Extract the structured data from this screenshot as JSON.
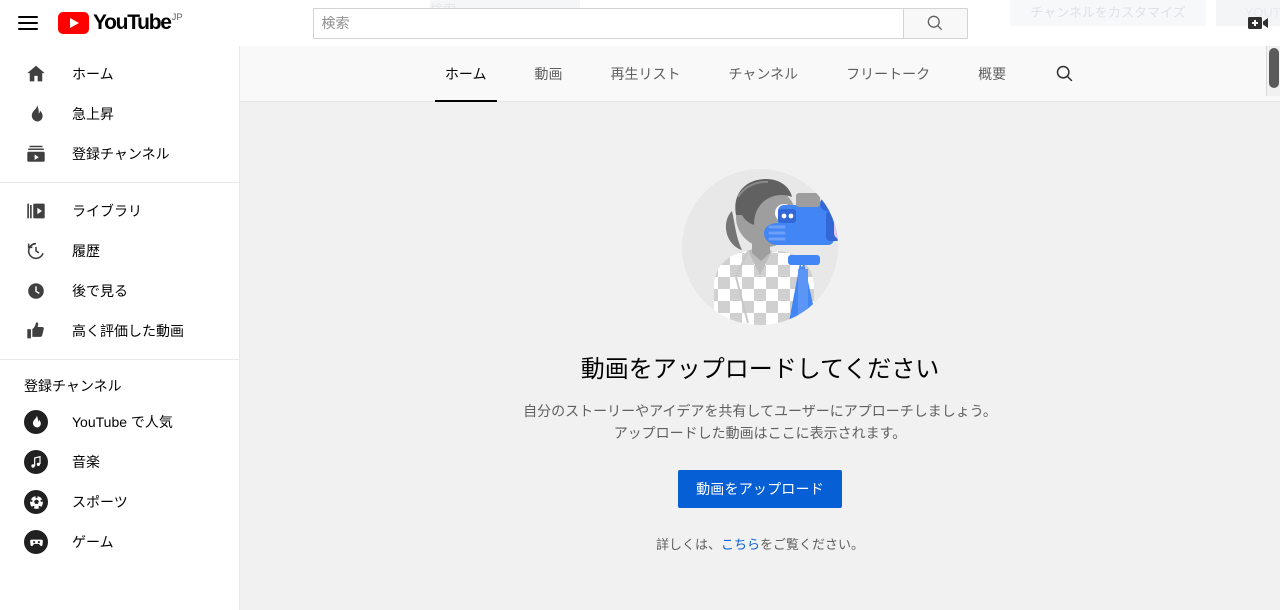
{
  "masthead": {
    "menu_icon": "hamburger-menu-icon",
    "logo_text": "YouTube",
    "logo_country": "JP",
    "search_placeholder": "検索",
    "search_value": "",
    "search_icon": "search-icon",
    "create_icon": "create-video-icon"
  },
  "ghost": {
    "customize_label": "チャンネルをカスタマイズ",
    "youtube_label": "YOUTUBE",
    "search_hint": "検索"
  },
  "sidebar": {
    "primary": [
      {
        "label": "ホーム",
        "icon": "home-icon"
      },
      {
        "label": "急上昇",
        "icon": "trending-flame-icon"
      },
      {
        "label": "登録チャンネル",
        "icon": "subscriptions-icon"
      }
    ],
    "library": [
      {
        "label": "ライブラリ",
        "icon": "library-icon"
      },
      {
        "label": "履歴",
        "icon": "history-clock-icon"
      },
      {
        "label": "後で見る",
        "icon": "watch-later-clock-icon"
      },
      {
        "label": "高く評価した動画",
        "icon": "thumbs-up-icon"
      }
    ],
    "subscriptions_heading": "登録チャンネル",
    "subscriptions": [
      {
        "label": "YouTube で人気",
        "icon": "flame-avatar-icon"
      },
      {
        "label": "音楽",
        "icon": "music-note-avatar-icon"
      },
      {
        "label": "スポーツ",
        "icon": "soccer-ball-avatar-icon"
      },
      {
        "label": "ゲーム",
        "icon": "gamepad-avatar-icon"
      }
    ]
  },
  "channel": {
    "tabs": [
      {
        "label": "ホーム",
        "active": true
      },
      {
        "label": "動画",
        "active": false
      },
      {
        "label": "再生リスト",
        "active": false
      },
      {
        "label": "チャンネル",
        "active": false
      },
      {
        "label": "フリートーク",
        "active": false
      },
      {
        "label": "概要",
        "active": false
      }
    ],
    "tab_search_icon": "search-icon",
    "empty": {
      "illustration": "person-filming-with-camera-illustration",
      "title": "動画をアップロードしてください",
      "desc_line1": "自分のストーリーやアイデアを共有してユーザーにアプローチしましょう。",
      "desc_line2": "アップロードした動画はここに表示されます。",
      "button_label": "動画をアップロード",
      "learn_prefix": "詳しくは、",
      "learn_link": "こちら",
      "learn_suffix": "をご覧ください。"
    }
  },
  "colors": {
    "brand_red": "#FF0000",
    "accent_blue": "#065FD4",
    "content_bg": "#F1F1F1",
    "tabbar_bg": "#F9F9F9"
  }
}
